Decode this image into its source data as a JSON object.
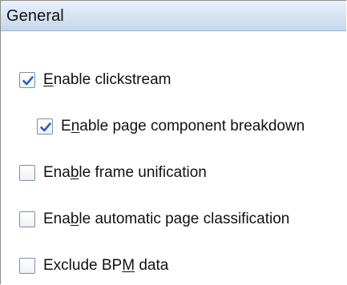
{
  "section": {
    "title": "General"
  },
  "options": [
    {
      "id": "enable-clickstream",
      "label_before": "",
      "mnemonic": "E",
      "label_after": "nable clickstream",
      "checked": true
    },
    {
      "id": "enable-page-component-breakdown",
      "label_before": "E",
      "mnemonic": "n",
      "label_after": "able page component breakdown",
      "checked": true
    },
    {
      "id": "enable-frame-unification",
      "label_before": "Ena",
      "mnemonic": "b",
      "label_after": "le frame unification",
      "checked": false
    },
    {
      "id": "enable-automatic-page-classification",
      "label_before": "Ena",
      "mnemonic": "b",
      "label_after": "le automatic page classification",
      "checked": false
    },
    {
      "id": "exclude-bpm-data",
      "label_before": "Exclude BP",
      "mnemonic": "M",
      "label_after": " data",
      "checked": false
    }
  ],
  "colors": {
    "checkmark": "#2a63b8",
    "header_gradient_top": "#e9f1fb",
    "header_gradient_bottom": "#c6d7ec"
  },
  "icons": {
    "checkmark": "check-icon"
  }
}
